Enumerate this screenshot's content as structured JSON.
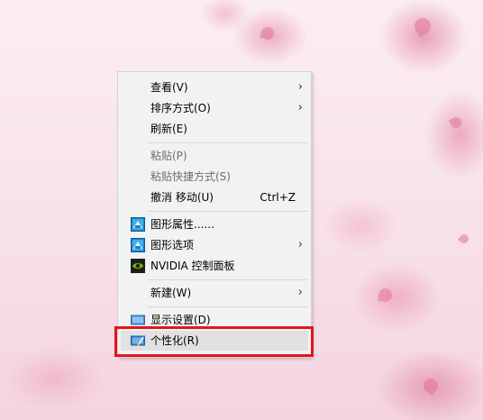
{
  "context_menu": {
    "view_label": "查看(V)",
    "sort_label": "排序方式(O)",
    "refresh_label": "刷新(E)",
    "paste_label": "粘贴(P)",
    "paste_shortcut_label": "粘贴快捷方式(S)",
    "undo_label": "撤消 移动(U)",
    "undo_shortcut": "Ctrl+Z",
    "graphics_properties_label": "图形属性......",
    "graphics_options_label": "图形选项",
    "nvidia_label": "NVIDIA 控制面板",
    "new_label": "新建(W)",
    "display_settings_label": "显示设置(D)",
    "personalize_label": "个性化(R)"
  },
  "icons": {
    "intel_graphics": "intel-graphics-icon",
    "nvidia": "nvidia-icon",
    "display": "display-settings-icon",
    "personalize": "personalize-icon",
    "submenu_arrow": "chevron-right-icon"
  },
  "colors": {
    "highlight_box": "#e3151c",
    "menu_background": "#f2f2f2",
    "hover_background": "#e1e1e1"
  }
}
